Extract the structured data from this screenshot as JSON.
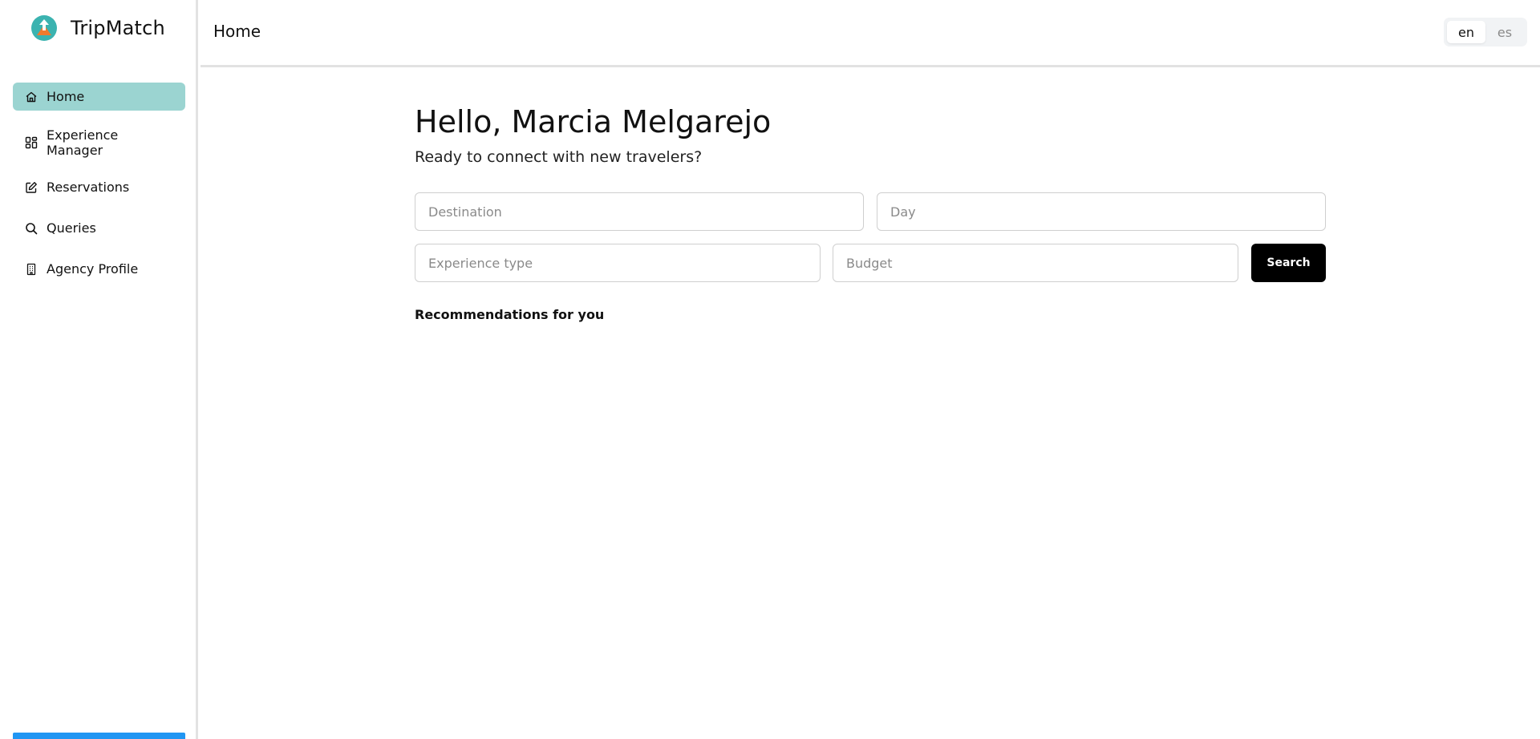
{
  "app": {
    "name": "TripMatch"
  },
  "sidebar": {
    "items": [
      {
        "label": "Home",
        "icon": "home-icon",
        "active": true
      },
      {
        "label": "Experience Manager",
        "icon": "dashboard-grid-icon",
        "active": false
      },
      {
        "label": "Reservations",
        "icon": "edit-square-icon",
        "active": false
      },
      {
        "label": "Queries",
        "icon": "search-icon",
        "active": false
      },
      {
        "label": "Agency Profile",
        "icon": "building-icon",
        "active": false
      }
    ]
  },
  "header": {
    "title": "Home",
    "languages": [
      {
        "code": "en",
        "active": true
      },
      {
        "code": "es",
        "active": false
      }
    ]
  },
  "main": {
    "greeting": "Hello, Marcia Melgarejo",
    "subtitle": "Ready to connect with new travelers?",
    "search": {
      "destination_placeholder": "Destination",
      "day_placeholder": "Day",
      "experience_type_placeholder": "Experience type",
      "budget_placeholder": "Budget",
      "button_label": "Search"
    },
    "recommendations_title": "Recommendations for you"
  },
  "colors": {
    "active_nav_bg": "#9bd4d1",
    "search_button_bg": "#000000",
    "bottom_bar": "#2196f3",
    "logo_teal": "#3bb3b0",
    "logo_orange": "#f07a2e"
  }
}
